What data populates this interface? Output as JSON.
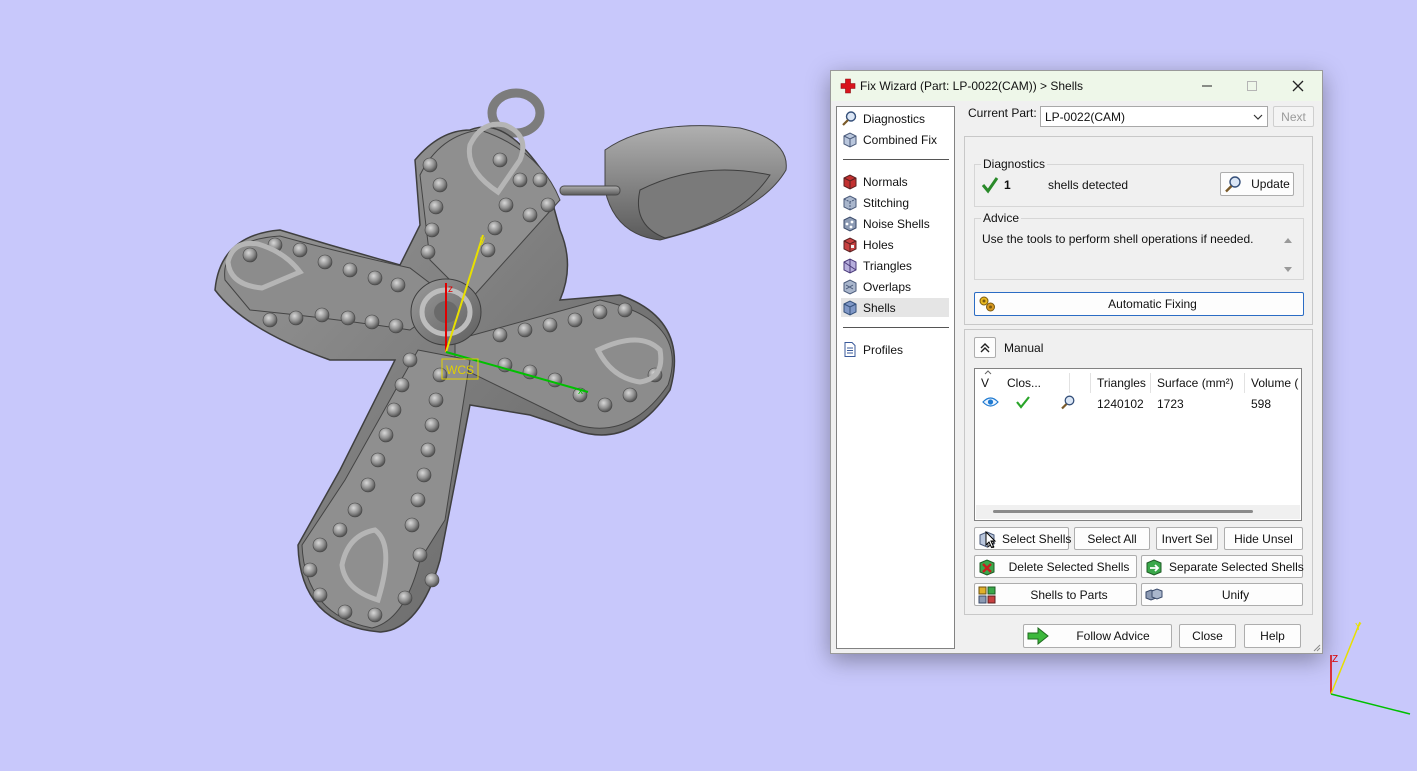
{
  "viewport": {
    "wcs_label": "WCS",
    "axis_z": "z",
    "axis_y": "y",
    "axis_x": "x",
    "corner_axis_y": "Y",
    "corner_axis_z": "Z"
  },
  "dialog": {
    "title": "Fix Wizard (Part: LP-0022(CAM)) > Shells",
    "nav": {
      "top_items": [
        {
          "label": "Diagnostics",
          "icon": "magnifier-icon"
        },
        {
          "label": "Combined Fix",
          "icon": "cube-icon"
        }
      ],
      "fix_items": [
        {
          "label": "Normals",
          "icon": "normals-cube-icon"
        },
        {
          "label": "Stitching",
          "icon": "stitching-cube-icon"
        },
        {
          "label": "Noise Shells",
          "icon": "noise-shells-icon"
        },
        {
          "label": "Holes",
          "icon": "holes-cube-icon"
        },
        {
          "label": "Triangles",
          "icon": "triangles-cube-icon"
        },
        {
          "label": "Overlaps",
          "icon": "overlaps-cube-icon"
        },
        {
          "label": "Shells",
          "icon": "shells-cube-icon"
        }
      ],
      "bottom_items": [
        {
          "label": "Profiles",
          "icon": "document-icon"
        }
      ],
      "active": "Shells"
    },
    "current_part_label": "Current Part:",
    "current_part_value": "LP-0022(CAM)",
    "next_label": "Next",
    "diagnostics": {
      "title": "Diagnostics",
      "count": "1",
      "text": "shells detected",
      "update_label": "Update"
    },
    "advice": {
      "title": "Advice",
      "text": "Use the tools to perform shell operations if needed."
    },
    "automatic_fixing_label": "Automatic Fixing",
    "manual": {
      "label": "Manual",
      "columns": [
        "V",
        "Clos...",
        "",
        "Triangles",
        "Surface (mm²)",
        "Volume ("
      ],
      "rows": [
        {
          "triangles": "1240102",
          "surface": "1723",
          "volume": "598"
        }
      ]
    },
    "buttons": {
      "select_shells": "Select Shells",
      "select_all": "Select All",
      "invert_sel": "Invert Sel",
      "hide_unsel": "Hide Unsel",
      "delete_selected": "Delete Selected Shells",
      "separate_selected": "Separate Selected Shells",
      "shells_to_parts": "Shells to Parts",
      "unify": "Unify"
    },
    "footer": {
      "follow_advice": "Follow Advice",
      "close": "Close",
      "help": "Help"
    }
  },
  "colors": {
    "background": "#c8c8fb",
    "accent_green": "#2aa52a",
    "title_bar": "#eef7e9"
  }
}
